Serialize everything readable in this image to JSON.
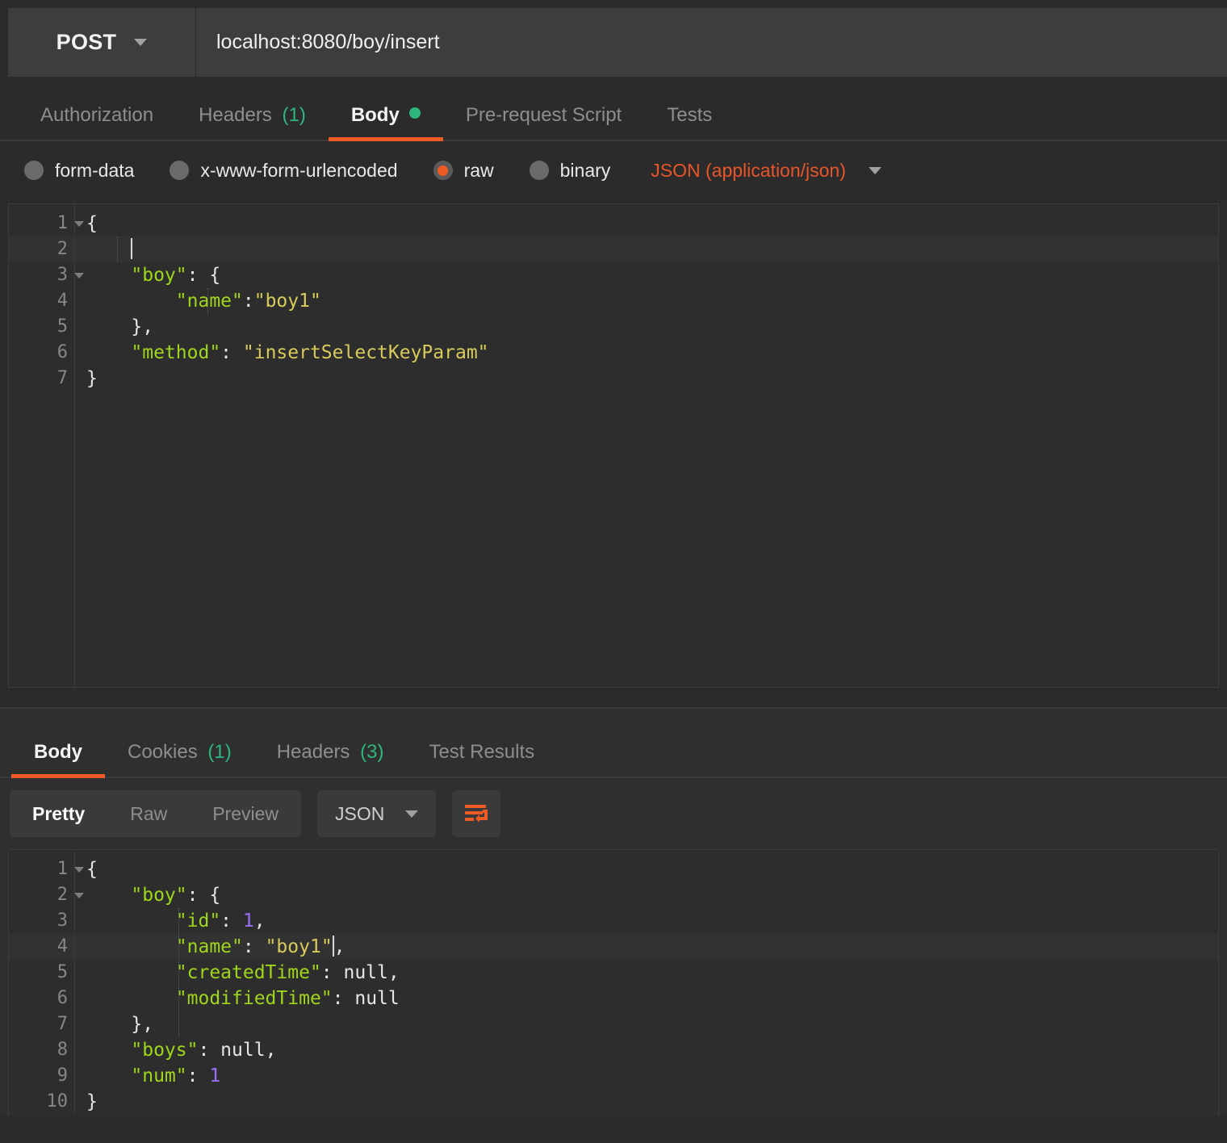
{
  "request": {
    "method": "POST",
    "method_icon": "chevron-down-icon",
    "url": "localhost:8080/boy/insert",
    "tabs": [
      {
        "label": "Authorization",
        "count": "",
        "active": false,
        "dot": false
      },
      {
        "label": "Headers",
        "count": "(1)",
        "active": false,
        "dot": false
      },
      {
        "label": "Body",
        "count": "",
        "active": true,
        "dot": true
      },
      {
        "label": "Pre-request Script",
        "count": "",
        "active": false,
        "dot": false
      },
      {
        "label": "Tests",
        "count": "",
        "active": false,
        "dot": false
      }
    ],
    "body_types": [
      {
        "label": "form-data",
        "selected": false
      },
      {
        "label": "x-www-form-urlencoded",
        "selected": false
      },
      {
        "label": "raw",
        "selected": true
      },
      {
        "label": "binary",
        "selected": false
      }
    ],
    "content_type": "JSON (application/json)",
    "editor": {
      "active_line": 2,
      "lines": [
        {
          "num": "1",
          "fold": true,
          "tokens": [
            {
              "t": "{",
              "c": "p"
            }
          ]
        },
        {
          "num": "2",
          "fold": false,
          "tokens": [
            {
              "t": "    ",
              "c": "p"
            }
          ],
          "cursor": true
        },
        {
          "num": "3",
          "fold": true,
          "tokens": [
            {
              "t": "    ",
              "c": "p"
            },
            {
              "t": "\"boy\"",
              "c": "k"
            },
            {
              "t": ": {",
              "c": "p"
            }
          ]
        },
        {
          "num": "4",
          "fold": false,
          "tokens": [
            {
              "t": "        ",
              "c": "p"
            },
            {
              "t": "\"name\"",
              "c": "k"
            },
            {
              "t": ":",
              "c": "p"
            },
            {
              "t": "\"boy1\"",
              "c": "s"
            }
          ]
        },
        {
          "num": "5",
          "fold": false,
          "tokens": [
            {
              "t": "    },",
              "c": "p"
            }
          ]
        },
        {
          "num": "6",
          "fold": false,
          "tokens": [
            {
              "t": "    ",
              "c": "p"
            },
            {
              "t": "\"method\"",
              "c": "k"
            },
            {
              "t": ": ",
              "c": "p"
            },
            {
              "t": "\"insertSelectKeyParam\"",
              "c": "s"
            }
          ]
        },
        {
          "num": "7",
          "fold": false,
          "tokens": [
            {
              "t": "}",
              "c": "p"
            }
          ]
        }
      ]
    }
  },
  "response": {
    "tabs": [
      {
        "label": "Body",
        "count": "",
        "active": true
      },
      {
        "label": "Cookies",
        "count": "(1)",
        "active": false
      },
      {
        "label": "Headers",
        "count": "(3)",
        "active": false
      },
      {
        "label": "Test Results",
        "count": "",
        "active": false
      }
    ],
    "view_modes": [
      {
        "label": "Pretty",
        "active": true
      },
      {
        "label": "Raw",
        "active": false
      },
      {
        "label": "Preview",
        "active": false
      }
    ],
    "format": "JSON",
    "wrap_icon": "word-wrap-icon",
    "editor": {
      "active_line": 4,
      "lines": [
        {
          "num": "1",
          "fold": true,
          "tokens": [
            {
              "t": "{",
              "c": "p"
            }
          ]
        },
        {
          "num": "2",
          "fold": true,
          "tokens": [
            {
              "t": "    ",
              "c": "p"
            },
            {
              "t": "\"boy\"",
              "c": "k"
            },
            {
              "t": ": {",
              "c": "p"
            }
          ]
        },
        {
          "num": "3",
          "fold": false,
          "tokens": [
            {
              "t": "        ",
              "c": "p"
            },
            {
              "t": "\"id\"",
              "c": "k"
            },
            {
              "t": ": ",
              "c": "p"
            },
            {
              "t": "1",
              "c": "n"
            },
            {
              "t": ",",
              "c": "p"
            }
          ]
        },
        {
          "num": "4",
          "fold": false,
          "tokens": [
            {
              "t": "        ",
              "c": "p"
            },
            {
              "t": "\"name\"",
              "c": "k"
            },
            {
              "t": ": ",
              "c": "p"
            },
            {
              "t": "\"boy1\"",
              "c": "s"
            },
            {
              "t": ",",
              "c": "p"
            }
          ],
          "cursor_after": true
        },
        {
          "num": "5",
          "fold": false,
          "tokens": [
            {
              "t": "        ",
              "c": "p"
            },
            {
              "t": "\"createdTime\"",
              "c": "k"
            },
            {
              "t": ": null,",
              "c": "p"
            }
          ]
        },
        {
          "num": "6",
          "fold": false,
          "tokens": [
            {
              "t": "        ",
              "c": "p"
            },
            {
              "t": "\"modifiedTime\"",
              "c": "k"
            },
            {
              "t": ": null",
              "c": "p"
            }
          ]
        },
        {
          "num": "7",
          "fold": false,
          "tokens": [
            {
              "t": "    },",
              "c": "p"
            }
          ]
        },
        {
          "num": "8",
          "fold": false,
          "tokens": [
            {
              "t": "    ",
              "c": "p"
            },
            {
              "t": "\"boys\"",
              "c": "k"
            },
            {
              "t": ": null,",
              "c": "p"
            }
          ]
        },
        {
          "num": "9",
          "fold": false,
          "tokens": [
            {
              "t": "    ",
              "c": "p"
            },
            {
              "t": "\"num\"",
              "c": "k"
            },
            {
              "t": ": ",
              "c": "p"
            },
            {
              "t": "1",
              "c": "n"
            }
          ]
        },
        {
          "num": "10",
          "fold": false,
          "tokens": [
            {
              "t": "}",
              "c": "p"
            }
          ]
        }
      ]
    }
  },
  "theme": {
    "accent": "#ef5b25",
    "green": "#2fb67c",
    "key_color": "#9fd61c",
    "string_color": "#d9cb5b",
    "number_color": "#9b6ef3",
    "bg": "#2b2b2b",
    "editor_bg": "#2d2d2d"
  }
}
